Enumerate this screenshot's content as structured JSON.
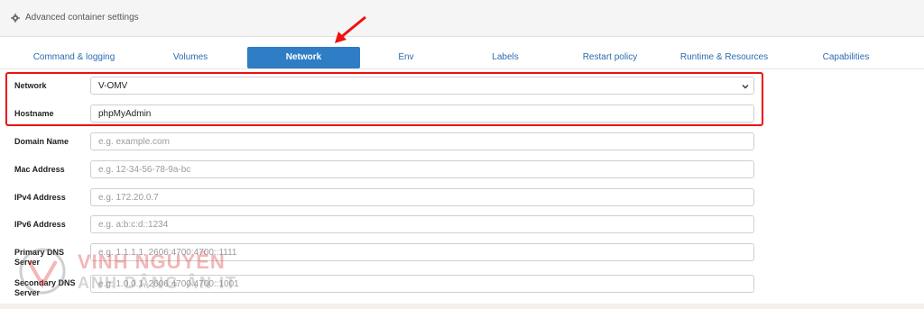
{
  "panel": {
    "title": "Advanced container settings",
    "icon": "gear-icon"
  },
  "tabs": [
    {
      "label": "Command & logging"
    },
    {
      "label": "Volumes"
    },
    {
      "label": "Network",
      "active": true
    },
    {
      "label": "Env"
    },
    {
      "label": "Labels"
    },
    {
      "label": "Restart policy"
    },
    {
      "label": "Runtime & Resources"
    },
    {
      "label": "Capabilities"
    }
  ],
  "form": {
    "network": {
      "label": "Network",
      "value": "V-OMV"
    },
    "hostname": {
      "label": "Hostname",
      "value": "phpMyAdmin"
    },
    "domain_name": {
      "label": "Domain Name",
      "placeholder": "e.g. example.com"
    },
    "mac_address": {
      "label": "Mac Address",
      "placeholder": "e.g. 12-34-56-78-9a-bc"
    },
    "ipv4": {
      "label": "IPv4 Address",
      "placeholder": "e.g. 172.20.0.7"
    },
    "ipv6": {
      "label": "IPv6 Address",
      "placeholder": "e.g. a:b:c:d::1234"
    },
    "primary_dns": {
      "label_line1": "Primary DNS",
      "label_line2": "Server",
      "placeholder": "e.g. 1.1.1.1, 2606:4700:4700::1111"
    },
    "secondary_dns": {
      "label_line1": "Secondary DNS",
      "label_line2": "Server",
      "placeholder": "e.g. 1.0.0.1, 2606:4700:4700::1001"
    }
  },
  "watermark": {
    "line1": "VINH NGUYỄN",
    "line2": "ANH DÂNG ÂN IT"
  },
  "colors": {
    "accent": "#2f7dc4",
    "highlight": "#e11111"
  }
}
